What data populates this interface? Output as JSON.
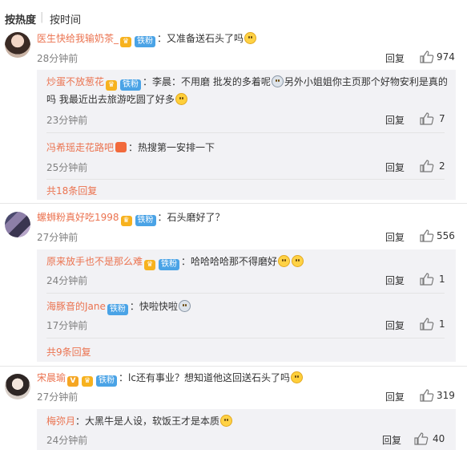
{
  "sort": {
    "hot": "按热度",
    "separator": "|",
    "time": "按时间"
  },
  "badges": {
    "vip": "♛",
    "fan": "铁粉",
    "fans_icon": "V"
  },
  "labels": {
    "reply": "回复"
  },
  "comments": [
    {
      "user": "医生快给我输奶茶_",
      "text": "：又准备送石头了吗",
      "time": "28分钟前",
      "likes": "974",
      "replies": [
        {
          "user": "炒蛋不放葱花",
          "text_a": "：李晨：不用磨 批发的多着呢",
          "text_b": "另外小姐姐你主页那个好物安利是真的吗 我最近出去旅游吃圆了好多",
          "time": "23分钟前",
          "likes": "7"
        },
        {
          "user": "冯希瑶走花路吧",
          "text_a": "：热搜第一安排一下",
          "text_b": "",
          "time": "25分钟前",
          "likes": "2"
        }
      ],
      "more": "共18条回复"
    },
    {
      "user": "螺蛳粉真好吃1998",
      "text": "：石头磨好了？",
      "time": "27分钟前",
      "likes": "556",
      "replies": [
        {
          "user": "原来放手也不是那么难",
          "text_a": "：哈哈哈哈那不得磨好",
          "text_b": "",
          "time": "24分钟前",
          "likes": "1"
        },
        {
          "user": "海豚音的Jane",
          "text_a": "：快啦快啦",
          "text_b": "",
          "time": "17分钟前",
          "likes": "1"
        }
      ],
      "more": "共9条回复"
    },
    {
      "user": "宋晨瑜",
      "text": "：lc还有事业？想知道他这回送石头了吗",
      "time": "27分钟前",
      "likes": "319",
      "replies": [
        {
          "user": "梅弥月",
          "text_a": "：大黑牛是人设，软饭王才是本质",
          "text_b": "",
          "time": "24分钟前",
          "likes": "40"
        }
      ],
      "more": ""
    }
  ],
  "icons": {
    "like": "thumbs-up-icon"
  }
}
